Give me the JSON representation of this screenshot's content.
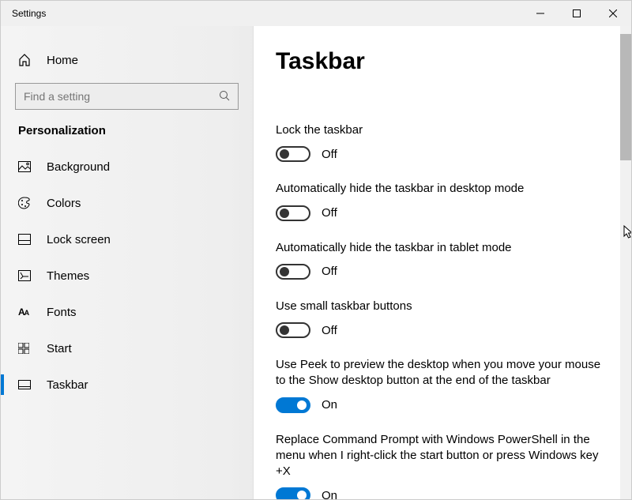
{
  "window": {
    "title": "Settings"
  },
  "sidebar": {
    "home": "Home",
    "search_placeholder": "Find a setting",
    "category": "Personalization",
    "items": [
      {
        "label": "Background"
      },
      {
        "label": "Colors"
      },
      {
        "label": "Lock screen"
      },
      {
        "label": "Themes"
      },
      {
        "label": "Fonts"
      },
      {
        "label": "Start"
      },
      {
        "label": "Taskbar"
      }
    ]
  },
  "page": {
    "title": "Taskbar",
    "settings": [
      {
        "label": "Lock the taskbar",
        "on": false,
        "state": "Off"
      },
      {
        "label": "Automatically hide the taskbar in desktop mode",
        "on": false,
        "state": "Off"
      },
      {
        "label": "Automatically hide the taskbar in tablet mode",
        "on": false,
        "state": "Off"
      },
      {
        "label": "Use small taskbar buttons",
        "on": false,
        "state": "Off"
      },
      {
        "label": "Use Peek to preview the desktop when you move your mouse to the Show desktop button at the end of the taskbar",
        "on": true,
        "state": "On"
      },
      {
        "label": "Replace Command Prompt with Windows PowerShell in the menu when I right-click the start button or press Windows key +X",
        "on": true,
        "state": "On"
      }
    ]
  }
}
